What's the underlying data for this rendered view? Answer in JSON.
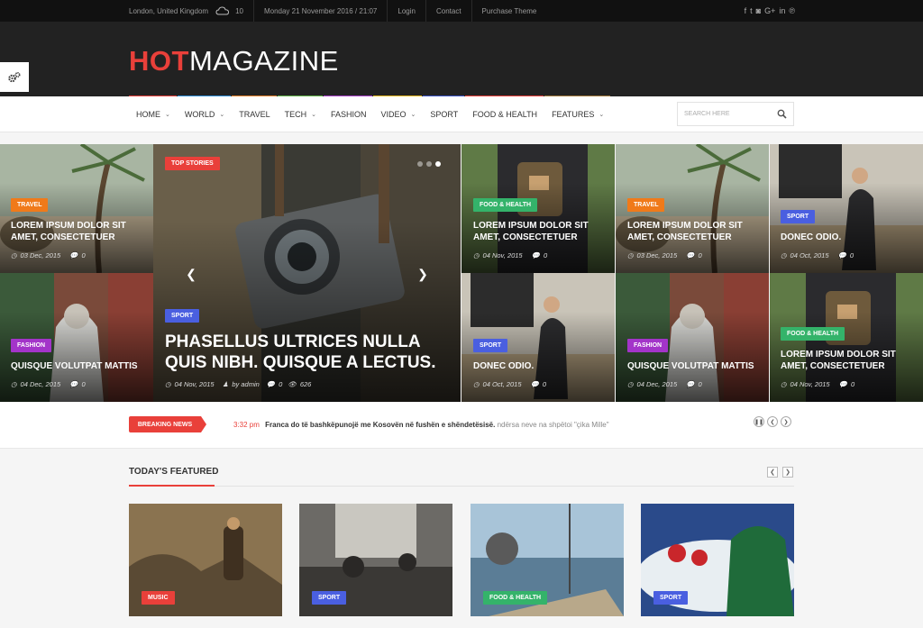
{
  "topbar": {
    "location": "London, United Kingdom",
    "temperature": "10",
    "datetime": "Monday 21 November 2016 / 21:07",
    "links": [
      "Login",
      "Contact",
      "Purchase Theme"
    ],
    "social_icons": [
      "facebook-icon",
      "twitter-icon",
      "instagram-icon",
      "google-plus-icon",
      "linkedin-icon",
      "pinterest-icon"
    ]
  },
  "logo": {
    "hot": "HOT",
    "magazine": "MAGAZINE"
  },
  "nav": {
    "items": [
      {
        "label": "HOME",
        "dropdown": true
      },
      {
        "label": "WORLD",
        "dropdown": true
      },
      {
        "label": "TRAVEL",
        "dropdown": false
      },
      {
        "label": "TECH",
        "dropdown": true
      },
      {
        "label": "FASHION",
        "dropdown": false
      },
      {
        "label": "VIDEO",
        "dropdown": true
      },
      {
        "label": "SPORT",
        "dropdown": false
      },
      {
        "label": "FOOD & HEALTH",
        "dropdown": false
      },
      {
        "label": "FEATURES",
        "dropdown": true
      }
    ],
    "colors": [
      "#e9403a",
      "#2f8fd8",
      "#e8822b",
      "#63b34a",
      "#a942c9",
      "#e9b81f",
      "#3a53c4",
      "#e9403a",
      "#a0783c"
    ],
    "search_placeholder": "SEARCH HERE"
  },
  "colors": {
    "accent": "#e9403a",
    "travel": "#f07a1a",
    "fashion": "#a334c9",
    "sport": "#4a5fe0",
    "food_health": "#34b36a",
    "music": "#e9403a"
  },
  "grid": {
    "left_top": {
      "category": "TRAVEL",
      "title_line1": "LOREM IPSUM DOLOR SIT",
      "title_line2": "AMET, CONSECTETUER",
      "date": "03 Dec, 2015",
      "comments": "0"
    },
    "left_bottom": {
      "category": "FASHION",
      "title": "QUISQUE VOLUTPAT MATTIS",
      "date": "04 Dec, 2015",
      "comments": "0"
    },
    "big": {
      "top_badge": "TOP STORIES",
      "category": "SPORT",
      "title": "PHASELLUS ULTRICES NULLA QUIS NIBH. QUISQUE A LECTUS.",
      "date": "04 Nov, 2015",
      "author": "by admin",
      "comments": "0",
      "views": "626"
    },
    "r1_top": {
      "category": "FOOD & HEALTH",
      "title_line1": "LOREM IPSUM DOLOR SIT",
      "title_line2": "AMET, CONSECTETUER",
      "date": "04 Nov, 2015",
      "comments": "0"
    },
    "r1_bottom": {
      "category": "SPORT",
      "title": "DONEC ODIO.",
      "date": "04 Oct, 2015",
      "comments": "0"
    },
    "r2_top": {
      "category": "TRAVEL",
      "title_line1": "LOREM IPSUM DOLOR SIT",
      "title_line2": "AMET, CONSECTETUER",
      "date": "03 Dec, 2015",
      "comments": "0"
    },
    "r2_bottom": {
      "category": "FASHION",
      "title": "QUISQUE VOLUTPAT MATTIS",
      "date": "04 Dec, 2015",
      "comments": "0"
    },
    "r3_top": {
      "category": "SPORT",
      "title": "DONEC ODIO.",
      "date": "04 Oct, 2015",
      "comments": "0"
    },
    "r3_bottom": {
      "category": "FOOD & HEALTH",
      "title_line1": "LOREM IPSUM DOLOR SIT",
      "title_line2": "AMET, CONSECTETUER",
      "date": "04 Nov, 2015",
      "comments": "0"
    }
  },
  "breaking": {
    "label": "BREAKING NEWS",
    "time": "3:32 pm",
    "headline": "Franca do të bashkëpunojë me Kosovën në fushën e shëndetësisë.",
    "rest": "ndërsa neve na shpëtoi \"çika Mille\""
  },
  "featured": {
    "heading": "TODAY'S FEATURED",
    "cards": [
      {
        "category": "MUSIC"
      },
      {
        "category": "SPORT"
      },
      {
        "category": "FOOD & HEALTH"
      },
      {
        "category": "SPORT"
      }
    ]
  }
}
